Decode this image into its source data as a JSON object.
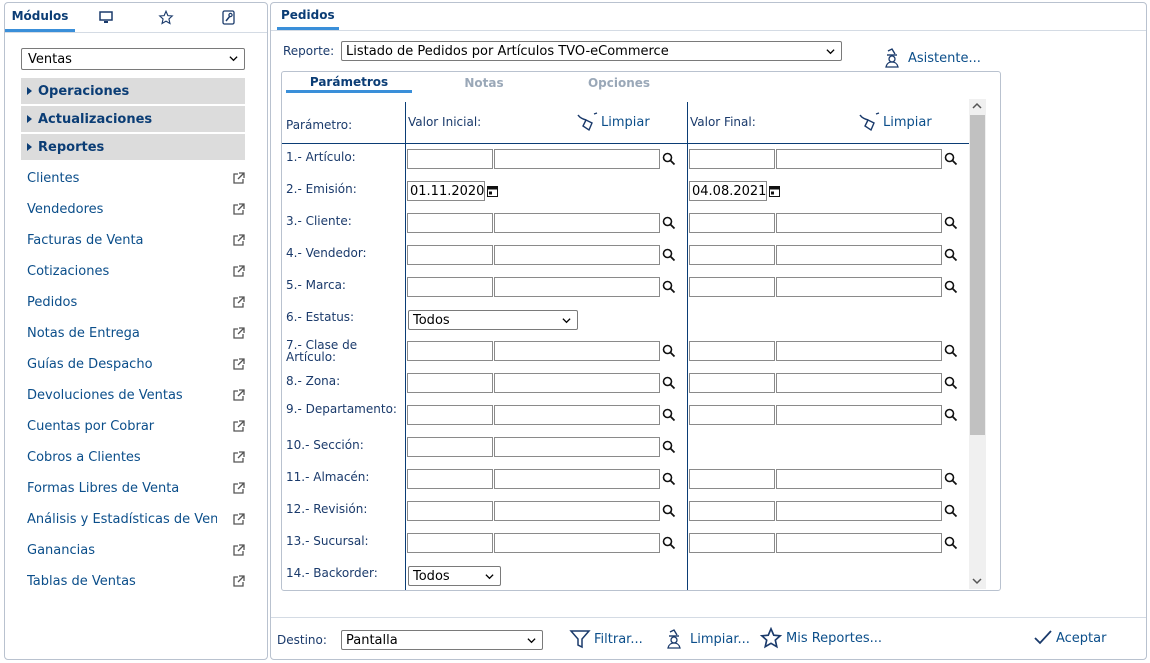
{
  "left": {
    "tabs": [
      {
        "label": "Módulos",
        "icon": "text"
      },
      {
        "icon": "monitor-icon"
      },
      {
        "icon": "star-icon"
      },
      {
        "icon": "wrench-icon"
      }
    ],
    "module_select": "Ventas",
    "accordions": [
      "Operaciones",
      "Actualizaciones",
      "Reportes"
    ],
    "items": [
      "Clientes",
      "Vendedores",
      "Facturas de Venta",
      "Cotizaciones",
      "Pedidos",
      "Notas de Entrega",
      "Guías de Despacho",
      "Devoluciones de Ventas",
      "Cuentas por Cobrar",
      "Cobros a Clientes",
      "Formas Libres de Venta",
      "Análisis y Estadísticas de Ventas",
      "Ganancias",
      "Tablas de Ventas"
    ]
  },
  "right": {
    "tab": "Pedidos",
    "report_label": "Reporte:",
    "report_value": "Listado de Pedidos por Artículos TVO-eCommerce",
    "assistant": "Asistente...",
    "param_tabs": [
      "Parámetros",
      "Notas",
      "Opciones"
    ],
    "headers": {
      "param": "Parámetro:",
      "initial": "Valor Inicial:",
      "final": "Valor Final:",
      "clear": "Limpiar"
    },
    "params": [
      {
        "label": "1.- Artículo:",
        "type": "range"
      },
      {
        "label": "2.- Emisión:",
        "type": "date",
        "initial": "01.11.2020",
        "final": "04.08.2021"
      },
      {
        "label": "3.- Cliente:",
        "type": "range"
      },
      {
        "label": "4.- Vendedor:",
        "type": "range"
      },
      {
        "label": "5.- Marca:",
        "type": "range"
      },
      {
        "label": "6.- Estatus:",
        "type": "select",
        "value": "Todos"
      },
      {
        "label": "7.- Clase de Artículo:",
        "type": "range"
      },
      {
        "label": "8.- Zona:",
        "type": "range"
      },
      {
        "label": "9.- Departamento:",
        "type": "range"
      },
      {
        "label": "10.- Sección:",
        "type": "single"
      },
      {
        "label": "11.- Almacén:",
        "type": "range"
      },
      {
        "label": "12.- Revisión:",
        "type": "range"
      },
      {
        "label": "13.- Sucursal:",
        "type": "range"
      },
      {
        "label": "14.- Backorder:",
        "type": "select_small",
        "value": "Todos"
      }
    ],
    "bottom": {
      "destino_label": "Destino:",
      "destino_value": "Pantalla",
      "filtrar": "Filtrar...",
      "limpiar": "Limpiar...",
      "mis_reportes": "Mis Reportes...",
      "aceptar": "Aceptar"
    }
  }
}
